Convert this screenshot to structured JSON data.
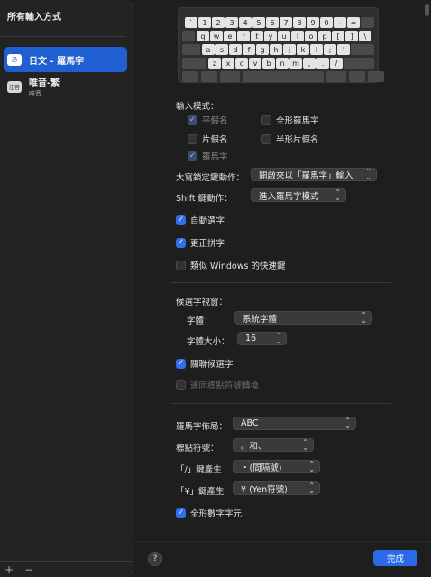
{
  "sidebar": {
    "title": "所有輸入方式",
    "items": [
      {
        "icon": "あ",
        "label": "日文 - 羅馬字",
        "sub": ""
      },
      {
        "icon": "注音",
        "label": "唯音-繁",
        "sub": "唯音"
      }
    ],
    "add": "+",
    "remove": "−"
  },
  "keyboard": {
    "row1": [
      "`",
      "1",
      "2",
      "3",
      "4",
      "5",
      "6",
      "7",
      "8",
      "9",
      "0",
      "-",
      "="
    ],
    "row2": [
      "q",
      "w",
      "e",
      "r",
      "t",
      "y",
      "u",
      "i",
      "o",
      "p",
      "[",
      "]",
      "\\"
    ],
    "row3": [
      "a",
      "s",
      "d",
      "f",
      "g",
      "h",
      "j",
      "k",
      "l",
      ";",
      "'"
    ],
    "row4": [
      "z",
      "x",
      "c",
      "v",
      "b",
      "n",
      "m",
      ",",
      ".",
      "/"
    ]
  },
  "input_mode": {
    "label": "輸入模式：",
    "hiragana": "平假名",
    "fullwidth_romaji": "全形羅馬字",
    "katakana": "片假名",
    "halfwidth_katakana": "半形片假名",
    "romaji": "羅馬字"
  },
  "caps_lock": {
    "label": "大寫鎖定鍵動作：",
    "value": "開啟來以「羅馬字」輸入"
  },
  "shift": {
    "label": "Shift 鍵動作：",
    "value": "進入羅馬字模式"
  },
  "options": {
    "auto_select": "自動選字",
    "correct_spelling": "更正拼字",
    "windows_shortcuts": "類似 Windows 的快速鍵"
  },
  "candidate": {
    "label": "候選字視窗：",
    "font_label": "字體：",
    "font_value": "系統字體",
    "size_label": "字體大小：",
    "size_value": "16",
    "related": "關聯候選字",
    "with_punct": "連同標點符號轉換"
  },
  "layout": {
    "romaji_layout_label": "羅馬字佈局：",
    "romaji_layout_value": "ABC",
    "punct_label": "標點符號：",
    "punct_value": "。和、",
    "slash_label": "「/」鍵產生",
    "slash_value": "・(間隔號)",
    "yen_label": "「¥」鍵產生",
    "yen_value": "¥ (Yen符號)",
    "fullwidth_numbers": "全形數字字元"
  },
  "footer": {
    "help": "?",
    "done": "完成"
  }
}
